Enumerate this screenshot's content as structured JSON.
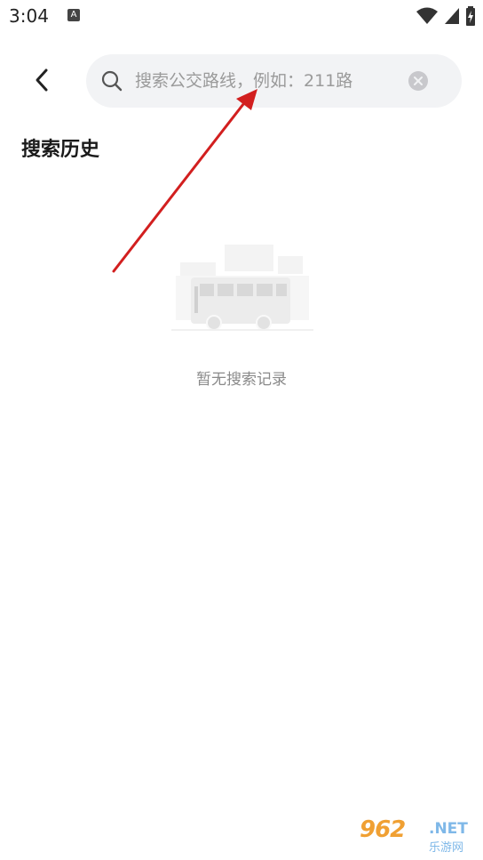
{
  "status_bar": {
    "time": "3:04",
    "notification_icon": "A",
    "icons": [
      "wifi-icon",
      "signal-icon",
      "battery-icon"
    ]
  },
  "header": {
    "back_icon": "chevron-left-icon",
    "search": {
      "placeholder": "搜索公交路线，例如：211路",
      "value": ""
    }
  },
  "history": {
    "title": "搜索历史",
    "empty_text": "暂无搜索记录"
  },
  "watermark": {
    "big": "962",
    "net": ".NET",
    "sub": "乐游网"
  },
  "colors": {
    "search_bg": "#f2f3f5",
    "arrow": "#d21f1f",
    "placeholder": "#9a9a9a"
  }
}
